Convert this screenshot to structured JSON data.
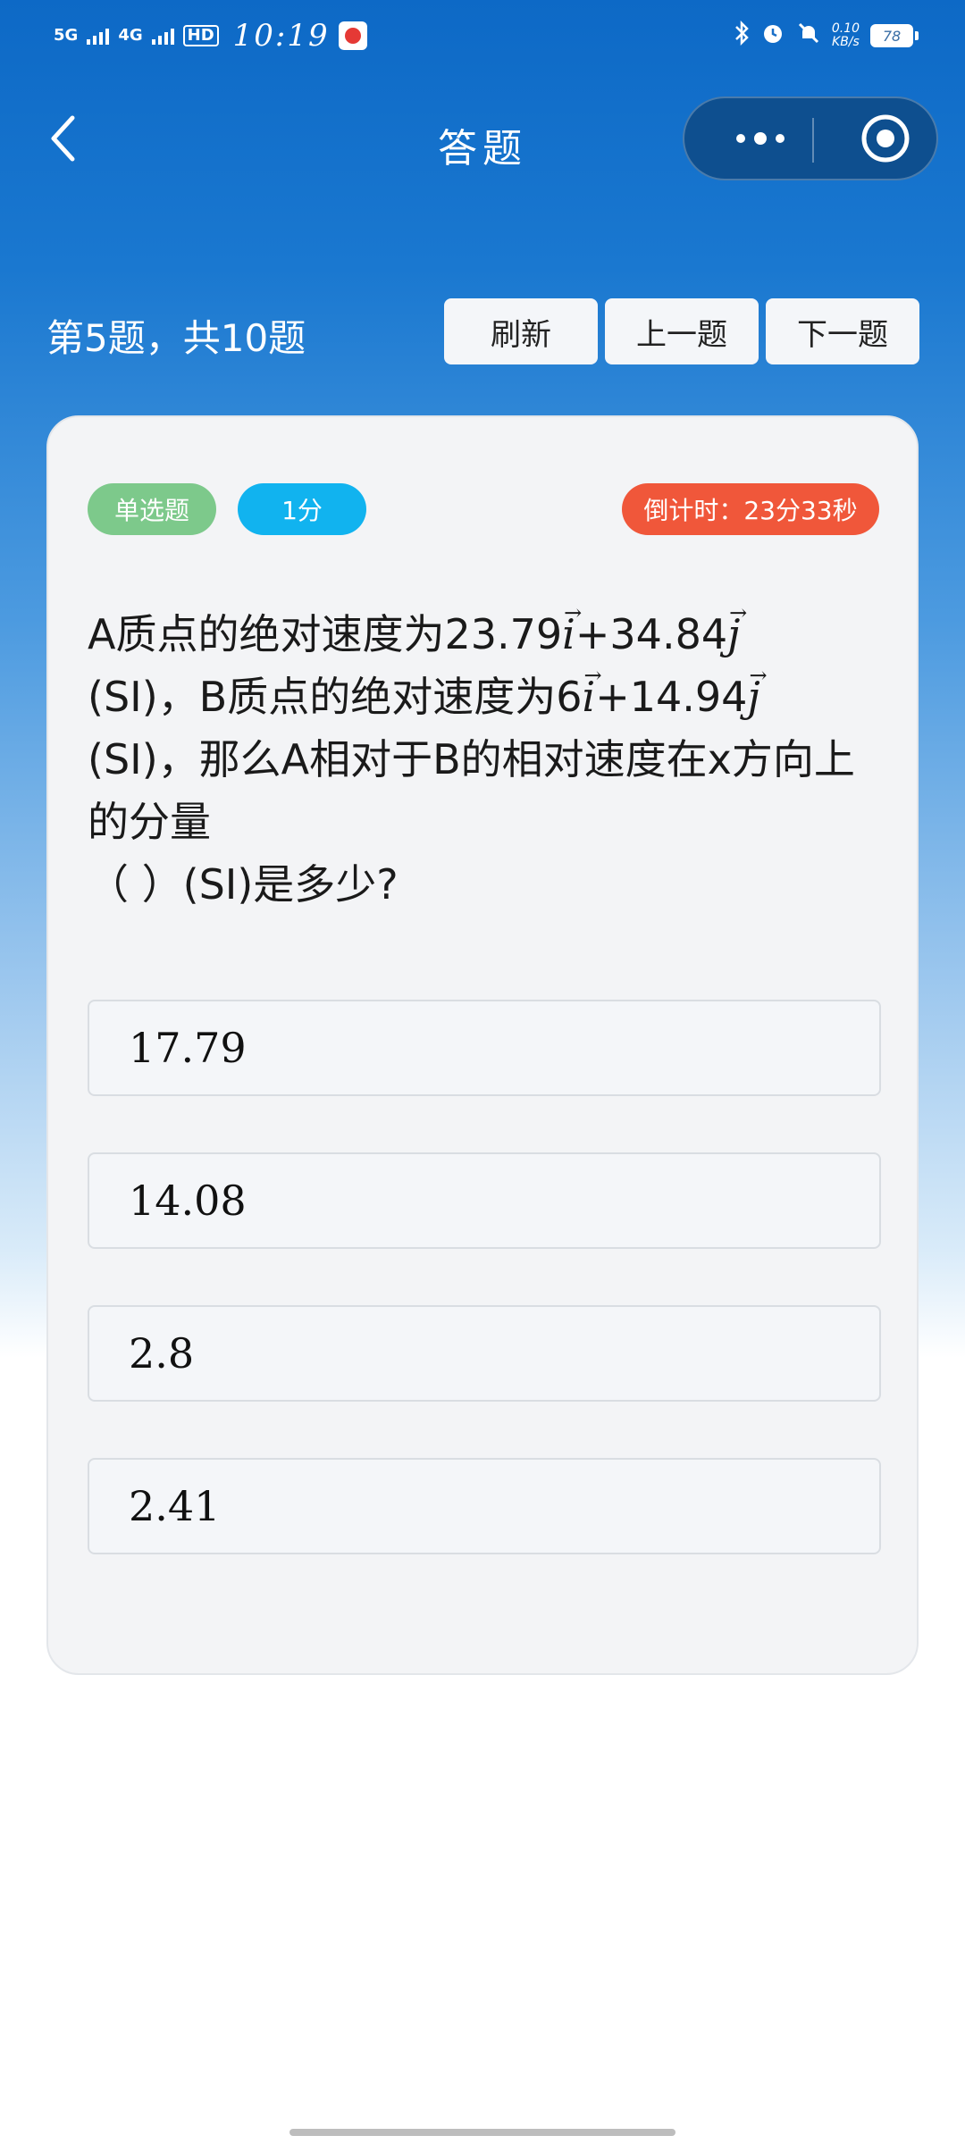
{
  "status_bar": {
    "network1": "5G",
    "network2": "4G",
    "hd": "HD",
    "time": "10:19",
    "speed_value": "0.10",
    "speed_unit": "KB/s",
    "battery": "78"
  },
  "header": {
    "title": "答题"
  },
  "progress": {
    "text": "第5题，共10题"
  },
  "nav": {
    "refresh": "刷新",
    "prev": "上一题",
    "next": "下一题"
  },
  "card": {
    "tags": {
      "type": "单选题",
      "score": "1分",
      "timer": "倒计时：23分33秒"
    },
    "question": {
      "l1a": "A质点的绝对速度为23.79",
      "l1b": "+34.84",
      "l2a": "(SI)，B质点的绝对速度为6",
      "l2b": "+14.94",
      "l3": "(SI)，那么A相对于B的相对速度在x方向上",
      "l4": "的分量",
      "l5": "（    ）(SI)是多少?",
      "vec_i": "i",
      "vec_j": "j"
    },
    "options": [
      "17.79",
      "14.08",
      "2.8",
      "2.41"
    ]
  },
  "icons": {
    "back": "chevron-left-icon",
    "more": "more-dots-icon",
    "close": "target-circle-icon"
  }
}
